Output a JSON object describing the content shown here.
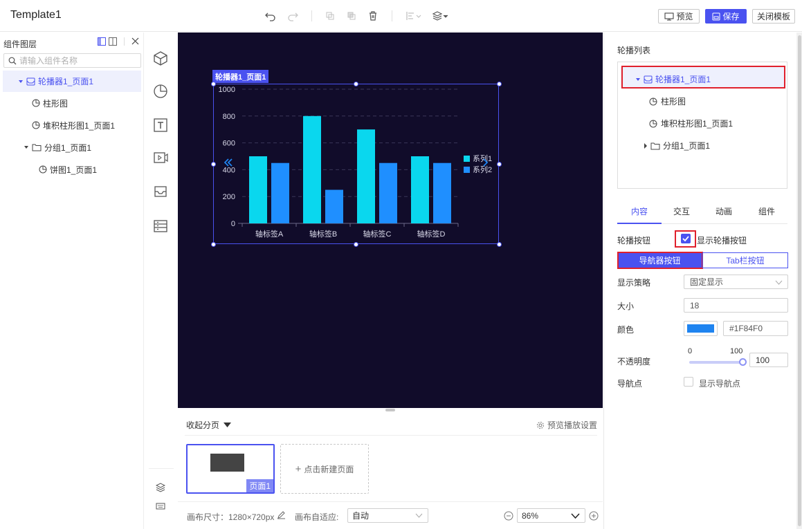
{
  "app": {
    "title": "Template1"
  },
  "toolbar": {
    "preview_label": "预览",
    "save_label": "保存",
    "close_label": "关闭模板"
  },
  "layers": {
    "title": "组件图层",
    "search_placeholder": "请输入组件名称",
    "items": [
      {
        "label": "轮播器1_页面1",
        "icon": "carousel-icon",
        "selected": true
      },
      {
        "label": "柱形图",
        "icon": "chart-icon"
      },
      {
        "label": "堆积柱形图1_页面1",
        "icon": "chart-icon"
      },
      {
        "label": "分组1_页面1",
        "icon": "folder-icon"
      },
      {
        "label": "饼图1_页面1",
        "icon": "chart-icon"
      }
    ]
  },
  "canvas": {
    "background": "#110c2a",
    "frame_tag": "轮播器1_页面1"
  },
  "chart_data": {
    "type": "bar",
    "categories": [
      "轴标签A",
      "轴标签B",
      "轴标签C",
      "轴标签D"
    ],
    "series": [
      {
        "name": "系列1",
        "values": [
          500,
          800,
          700,
          500
        ],
        "color": "#0ad7ee"
      },
      {
        "name": "系列2",
        "values": [
          450,
          250,
          450,
          450
        ],
        "color": "#1f8fff"
      }
    ],
    "ylim": [
      0,
      1000
    ],
    "yticks": [
      "0",
      "200",
      "400",
      "600",
      "800",
      "1000"
    ],
    "grid": true,
    "legend": "right"
  },
  "pages": {
    "collapse_label": "收起分页",
    "settings_label": "预览播放设置",
    "thumb_label": "页面1",
    "new_page_label": "点击新建页面"
  },
  "status": {
    "canvas_size_label": "画布尺寸：1280×720px",
    "fit_label": "画布自适应:",
    "fit_value": "自动",
    "zoom_value": "86%"
  },
  "props": {
    "carousel_list_title": "轮播列表",
    "tree": [
      {
        "label": "轮播器1_页面1",
        "selected": true
      },
      {
        "label": "柱形图"
      },
      {
        "label": "堆积柱形图1_页面1"
      },
      {
        "label": "分组1_页面1"
      }
    ],
    "tabs": [
      "内容",
      "交互",
      "动画",
      "组件"
    ],
    "active_tab": "内容",
    "carousel_btn_label": "轮播按钮",
    "show_carousel_btn": "显示轮播按钮",
    "nav_btn_label": "导航器按钮",
    "tab_btn_label": "Tab栏按钮",
    "strategy_label": "显示策略",
    "strategy_value": "固定显示",
    "size_label": "大小",
    "size_value": "18",
    "color_label": "颜色",
    "color_value": "#1F84F0",
    "opacity_label": "不透明度",
    "opacity_min": "0",
    "opacity_max": "100",
    "opacity_value": "100",
    "nav_dot_label": "导航点",
    "show_nav_dot": "显示导航点"
  },
  "colors": {
    "accent": "#4a52f0",
    "highlight": "#e0202c"
  }
}
